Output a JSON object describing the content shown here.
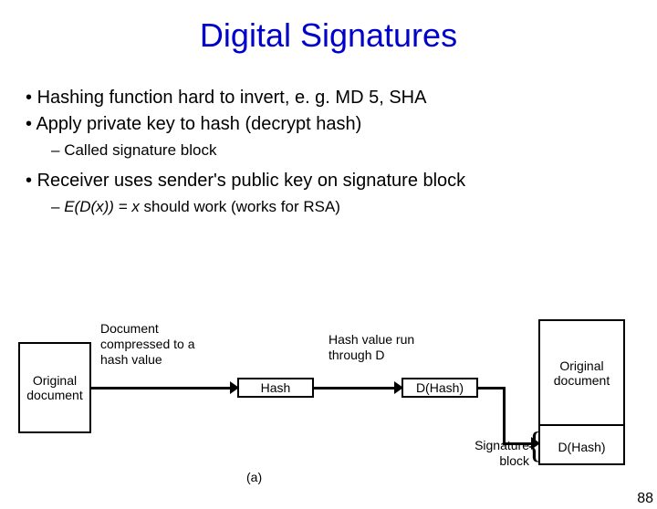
{
  "title": "Digital Signatures",
  "bullets": {
    "item1": "Hashing function hard to invert, e. g. MD 5, SHA",
    "item2": "Apply private key to hash (decrypt hash)",
    "item2_sub": "Called signature block",
    "item3": "Receiver uses sender's public key on signature block",
    "item3_sub_prefix": "E(D(x)) = x",
    "item3_sub_rest": " should work (works for RSA)"
  },
  "diagram": {
    "orig_doc": "Original document",
    "compress_label": "Document compressed to a hash value",
    "hash_box": "Hash",
    "hash_run_label": "Hash value run through D",
    "dhash_box": "D(Hash)",
    "right_orig": "Original document",
    "right_dhash": "D(Hash)",
    "caption_a": "(a)",
    "sig_block": "Signature block"
  },
  "page_number": "88"
}
